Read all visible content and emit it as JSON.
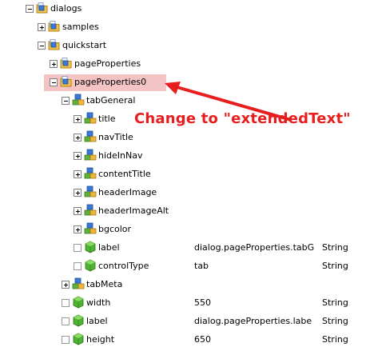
{
  "tree": {
    "rows": [
      {
        "label": "dialogs",
        "toggle": "minus",
        "icon": "folder-node-icon"
      },
      {
        "label": "samples",
        "toggle": "plus",
        "icon": "folder-node-icon"
      },
      {
        "label": "quickstart",
        "toggle": "minus",
        "icon": "folder-node-icon"
      },
      {
        "label": "pageProperties",
        "toggle": "plus",
        "icon": "folder-node-icon"
      },
      {
        "label": "pageProperties0",
        "toggle": "minus",
        "icon": "folder-node-icon",
        "highlighted": true
      },
      {
        "label": "tabGeneral",
        "toggle": "minus",
        "icon": "blue-node-icon"
      },
      {
        "label": "title",
        "toggle": "plus",
        "icon": "blue-node-icon"
      },
      {
        "label": "navTitle",
        "toggle": "plus",
        "icon": "blue-node-icon"
      },
      {
        "label": "hideInNav",
        "toggle": "plus",
        "icon": "blue-node-icon"
      },
      {
        "label": "contentTitle",
        "toggle": "plus",
        "icon": "blue-node-icon"
      },
      {
        "label": "headerImage",
        "toggle": "plus",
        "icon": "blue-node-icon"
      },
      {
        "label": "headerImageAlt",
        "toggle": "plus",
        "icon": "blue-node-icon"
      },
      {
        "label": "bgcolor",
        "toggle": "plus",
        "icon": "blue-node-icon"
      },
      {
        "label": "label",
        "toggle": "empty",
        "icon": "green-property-icon",
        "value": "dialog.pageProperties.tabG",
        "type": "String"
      },
      {
        "label": "controlType",
        "toggle": "empty",
        "icon": "green-property-icon",
        "value": "tab",
        "type": "String"
      },
      {
        "label": "tabMeta",
        "toggle": "plus",
        "icon": "blue-node-icon"
      },
      {
        "label": "width",
        "toggle": "empty",
        "icon": "green-property-icon",
        "value": "550",
        "type": "String"
      },
      {
        "label": "label",
        "toggle": "empty",
        "icon": "green-property-icon",
        "value": "dialog.pageProperties.labe",
        "type": "String"
      },
      {
        "label": "height",
        "toggle": "empty",
        "icon": "green-property-icon",
        "value": "650",
        "type": "String"
      }
    ]
  },
  "annotation": {
    "text": "Change to \"extendedText\"",
    "color": "#e81e1e"
  }
}
